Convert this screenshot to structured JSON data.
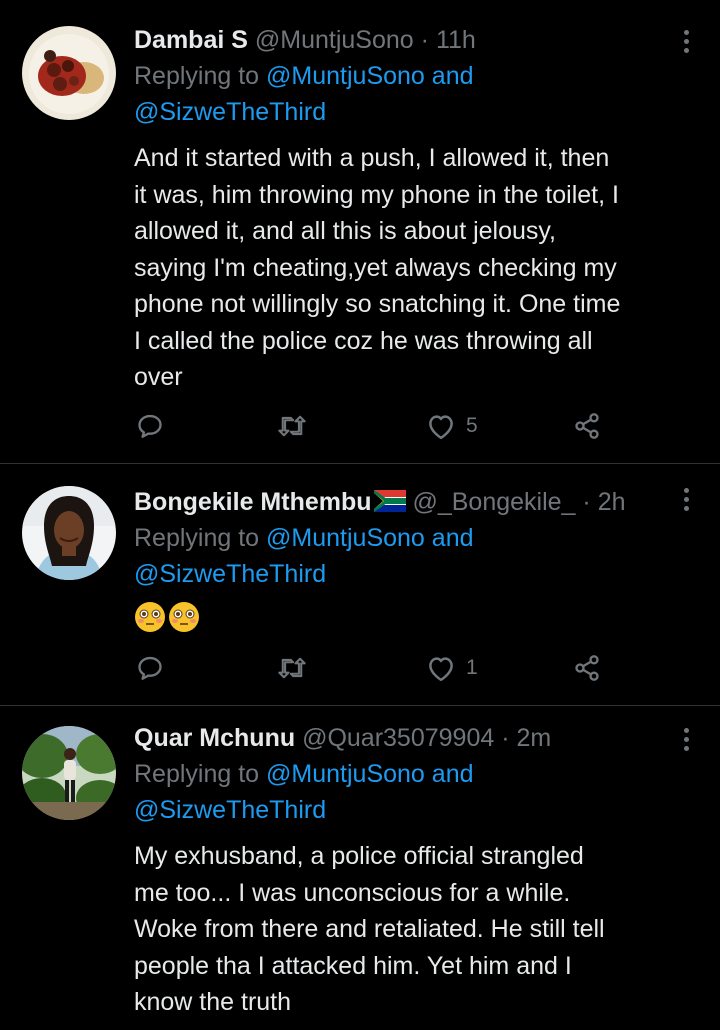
{
  "colors": {
    "background": "#000000",
    "text": "#e7e9ea",
    "muted": "#71767b",
    "link": "#1d9bf0",
    "divider": "#2f3336"
  },
  "tweets": [
    {
      "name": "Dambai S",
      "handle": "@MuntjuSono",
      "separator": "·",
      "time": "11h",
      "reply_prefix": "Replying to",
      "reply_mention_1": "@MuntjuSono",
      "reply_and": "and",
      "reply_mention_2": "@SizweTheThird",
      "body_lines": [
        "And it started with a push, I allowed it, then",
        "it was, him throwing my phone in the toilet, I",
        "allowed it, and all this is about jelousy,",
        "saying I'm cheating,yet always checking my",
        "phone not willingly so snatching it. One time",
        "I called the police coz he was throwing all",
        "over"
      ],
      "like_count": "5",
      "avatar_icon": "food-plate-avatar"
    },
    {
      "name": "Bongekile Mthembu",
      "name_flag_icon": "south-africa-flag-icon",
      "handle": "@_Bongekile_",
      "separator": "·",
      "time": "2h",
      "reply_prefix": "Replying to",
      "reply_mention_1": "@MuntjuSono",
      "reply_and": "and",
      "reply_mention_2": "@SizweTheThird",
      "body_emojis": [
        "flushed-face-emoji",
        "flushed-face-emoji"
      ],
      "like_count": "1",
      "avatar_icon": "person-photo-avatar"
    },
    {
      "name": "Quar Mchunu",
      "handle": "@Quar35079904",
      "separator": "·",
      "time": "2m",
      "reply_prefix": "Replying to",
      "reply_mention_1": "@MuntjuSono",
      "reply_and": "and",
      "reply_mention_2": "@SizweTheThird",
      "body_lines": [
        "My exhusband,  a police official strangled",
        "me too... I was unconscious for a while.",
        "Woke from there and retaliated. He still tell",
        "people tha I attacked him. Yet him and I",
        "know the truth"
      ],
      "avatar_icon": "garden-person-avatar"
    }
  ]
}
